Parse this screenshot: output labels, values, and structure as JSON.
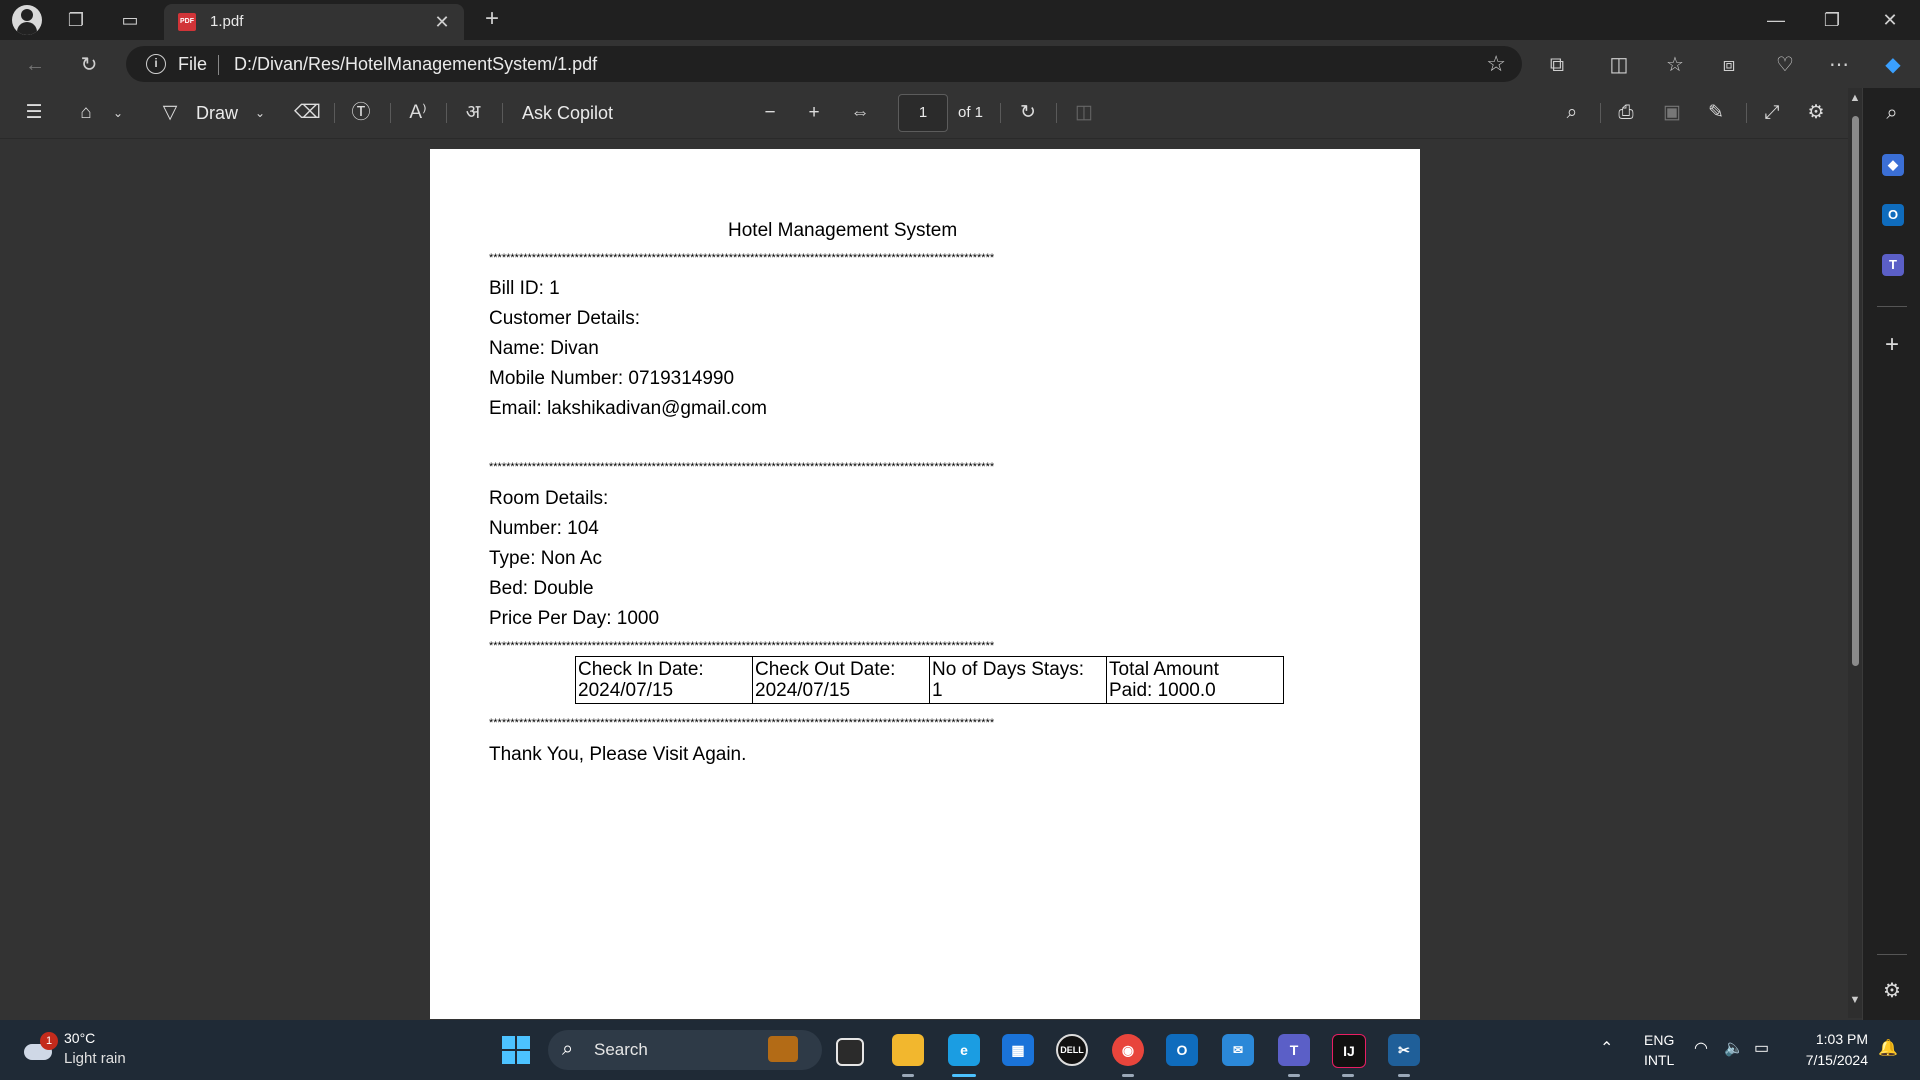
{
  "browser": {
    "tab_title": "1.pdf",
    "address_scheme": "File",
    "address_url": "D:/Divan/Res/HotelManagementSystem/1.pdf"
  },
  "pdf_toolbar": {
    "draw_label": "Draw",
    "ask_copilot_label": "Ask Copilot",
    "current_page": "1",
    "page_count_label": "of 1"
  },
  "document": {
    "title": "Hotel Management System",
    "separator": "**********************************************************************************************************************",
    "bill_id": "Bill ID: 1",
    "customer_heading": "Customer Details:",
    "name": "Name: Divan",
    "mobile": "Mobile Number: 0719314990",
    "email": "Email: lakshikadivan@gmail.com",
    "room_heading": "Room Details:",
    "room_number": "Number: 104",
    "room_type": "Type: Non Ac",
    "bed": "Bed: Double",
    "price": "Price Per Day: 1000",
    "table": [
      {
        "header": "Check In Date:",
        "value": "2024/07/15"
      },
      {
        "header": "Check Out Date:",
        "value": "2024/07/15"
      },
      {
        "header": "No of Days Stays:",
        "value": "1"
      },
      {
        "header": "Total Amount",
        "value": "Paid: 1000.0"
      }
    ],
    "footer": "Thank You, Please Visit Again."
  },
  "taskbar": {
    "weather_badge": "1",
    "temperature": "30°C",
    "condition": "Light rain",
    "search_label": "Search",
    "language": "ENG",
    "layout": "INTL",
    "time": "1:03 PM",
    "date": "7/15/2024"
  },
  "icons": {
    "pdf_badge": "PDF"
  }
}
